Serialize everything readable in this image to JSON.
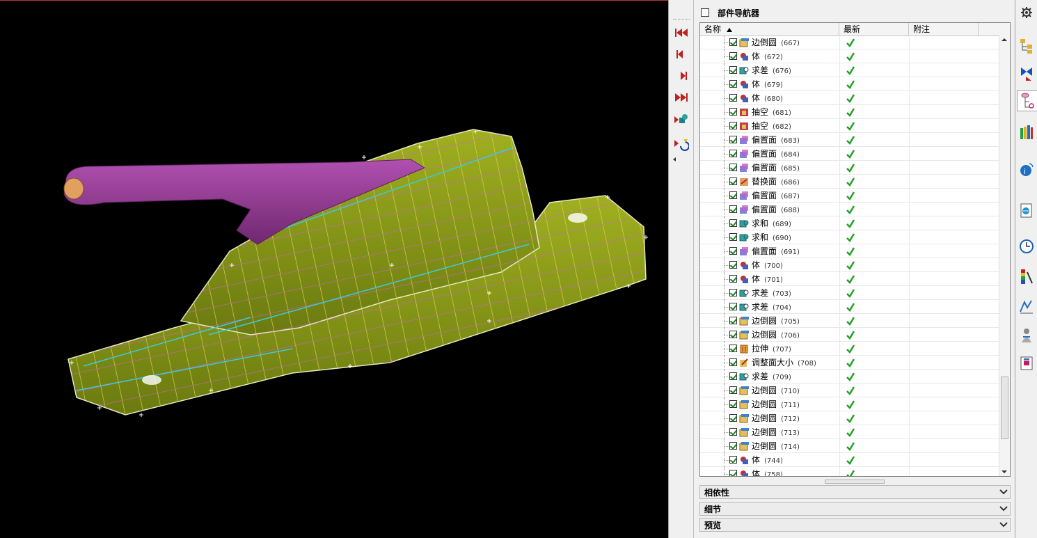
{
  "navigator": {
    "title": "部件导航器",
    "columns": {
      "name": "名称",
      "latest": "最新",
      "note": "附注"
    },
    "features": [
      {
        "name": "边倒圆",
        "id": "(667)",
        "type": "blend"
      },
      {
        "name": "体",
        "id": "(672)",
        "type": "body"
      },
      {
        "name": "求差",
        "id": "(676)",
        "type": "subtract"
      },
      {
        "name": "体",
        "id": "(679)",
        "type": "body"
      },
      {
        "name": "体",
        "id": "(680)",
        "type": "body"
      },
      {
        "name": "抽空",
        "id": "(681)",
        "type": "hollow"
      },
      {
        "name": "抽空",
        "id": "(682)",
        "type": "hollow"
      },
      {
        "name": "偏置面",
        "id": "(683)",
        "type": "offset"
      },
      {
        "name": "偏置面",
        "id": "(684)",
        "type": "offset"
      },
      {
        "name": "偏置面",
        "id": "(685)",
        "type": "offset"
      },
      {
        "name": "替换面",
        "id": "(686)",
        "type": "replace"
      },
      {
        "name": "偏置面",
        "id": "(687)",
        "type": "offset"
      },
      {
        "name": "偏置面",
        "id": "(688)",
        "type": "offset"
      },
      {
        "name": "求和",
        "id": "(689)",
        "type": "unite"
      },
      {
        "name": "求和",
        "id": "(690)",
        "type": "unite"
      },
      {
        "name": "偏置面",
        "id": "(691)",
        "type": "offset"
      },
      {
        "name": "体",
        "id": "(700)",
        "type": "body"
      },
      {
        "name": "体",
        "id": "(701)",
        "type": "body"
      },
      {
        "name": "求差",
        "id": "(703)",
        "type": "subtract"
      },
      {
        "name": "求差",
        "id": "(704)",
        "type": "subtract"
      },
      {
        "name": "边倒圆",
        "id": "(705)",
        "type": "blend"
      },
      {
        "name": "边倒圆",
        "id": "(706)",
        "type": "blend"
      },
      {
        "name": "拉伸",
        "id": "(707)",
        "type": "extrude"
      },
      {
        "name": "调整面大小",
        "id": "(708)",
        "type": "resize"
      },
      {
        "name": "求差",
        "id": "(709)",
        "type": "subtract"
      },
      {
        "name": "边倒圆",
        "id": "(710)",
        "type": "blend"
      },
      {
        "name": "边倒圆",
        "id": "(711)",
        "type": "blend"
      },
      {
        "name": "边倒圆",
        "id": "(712)",
        "type": "blend"
      },
      {
        "name": "边倒圆",
        "id": "(713)",
        "type": "blend"
      },
      {
        "name": "边倒圆",
        "id": "(714)",
        "type": "blend"
      },
      {
        "name": "体",
        "id": "(744)",
        "type": "body"
      },
      {
        "name": "体",
        "id": "(758)",
        "type": "body"
      }
    ]
  },
  "sections": {
    "dependencies": "相依性",
    "details": "细节",
    "preview": "预览"
  },
  "colors": {
    "model_body": "#8a9a1a",
    "handle": "#9a3c9a",
    "pin": "#e0a060",
    "accent_red": "#c02020",
    "check_green": "#20a020"
  },
  "icons": {
    "vcr": [
      "rewind-to-start-icon",
      "step-back-icon",
      "step-forward-icon",
      "fast-forward-icon",
      "make-current-icon",
      "replay-icon"
    ],
    "resource_bar": [
      "assembly-navigator-icon",
      "constraint-navigator-icon",
      "part-navigator-icon",
      "reuse-library-icon",
      "web-browser-icon",
      "ug-online-icon",
      "history-icon",
      "visualization-palette-icon",
      "process-studio-icon",
      "roles-icon",
      "system-scenes-icon"
    ]
  }
}
